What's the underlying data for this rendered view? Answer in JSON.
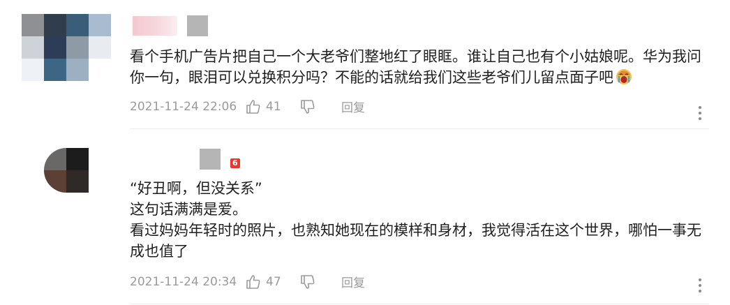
{
  "comments": [
    {
      "text_lines": [
        "看个手机广告片把自己一个大老爷们整地红了眼眶。谁让自己也有个小姑娘呢。华为我问",
        "你一句，眼泪可以兑换积分吗？不能的话就给我们这些老爷们儿留点面子吧"
      ],
      "emoji": "crying-face-emoji",
      "time": "2021-11-24 22:06",
      "likes": "41",
      "reply_label": "回复",
      "avatar_colors": [
        "#8e9094",
        "#2f3d4c",
        "#3a5d7a",
        "#a9bccf",
        "#cfd3d9",
        "#2d3d58",
        "#8e9aa5",
        "#e8ecf1",
        "#eef2f6",
        "#3d6584",
        "#9cb0c2",
        "#ffffff"
      ]
    },
    {
      "text_lines": [
        "“好丑啊，但没关系”",
        "这句话满满是爱。",
        "看过妈妈年轻时的照片，也熟知她现在的模样和身材，我觉得活在这个世界，哪怕一事无",
        "成也值了"
      ],
      "badge": "6",
      "time": "2021-11-24 20:34",
      "likes": "47",
      "reply_label": "回复",
      "avatar_colors": [
        "#6a6767",
        "#1d1c1c",
        "#5c3f35",
        "#2f2a28"
      ]
    }
  ]
}
